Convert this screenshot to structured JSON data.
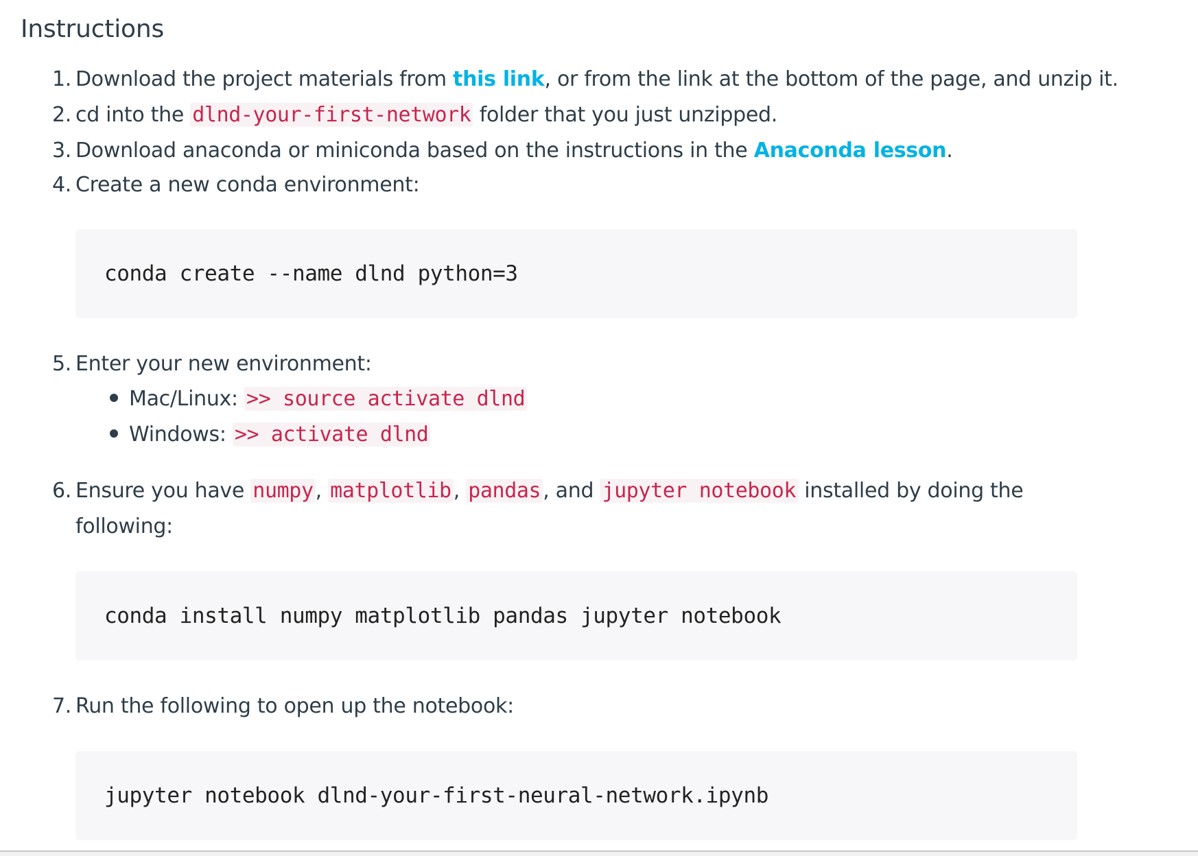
{
  "heading": "Instructions",
  "steps": {
    "s1": {
      "num": "1.",
      "pre": "Download the project materials from ",
      "link": "this link",
      "post": ", or from the link at the bottom of the page, and unzip it."
    },
    "s2": {
      "num": "2.",
      "pre": "cd into the ",
      "code": "dlnd-your-first-network",
      "post": " folder that you just unzipped."
    },
    "s3": {
      "num": "3.",
      "pre": "Download anaconda or miniconda based on the instructions in the ",
      "link": "Anaconda lesson",
      "post": "."
    },
    "s4": {
      "num": "4.",
      "text": "Create a new conda environment:",
      "code_block": "conda create --name dlnd python=3"
    },
    "s5": {
      "num": "5.",
      "text": "Enter your new environment:",
      "bullets": [
        {
          "label": "Mac/Linux: ",
          "code": ">> source activate dlnd"
        },
        {
          "label": "Windows: ",
          "code": ">> activate dlnd"
        }
      ]
    },
    "s6": {
      "num": "6.",
      "pre": "Ensure you have ",
      "code1": "numpy",
      "sep1": ", ",
      "code2": "matplotlib",
      "sep2": ", ",
      "code3": "pandas",
      "sep3": ", and ",
      "code4": "jupyter notebook",
      "post": " installed by doing the",
      "line2": "following:",
      "code_block": "conda install numpy matplotlib pandas jupyter notebook"
    },
    "s7": {
      "num": "7.",
      "text": "Run the following to open up the notebook:",
      "code_block": "jupyter notebook dlnd-your-first-neural-network.ipynb"
    }
  }
}
